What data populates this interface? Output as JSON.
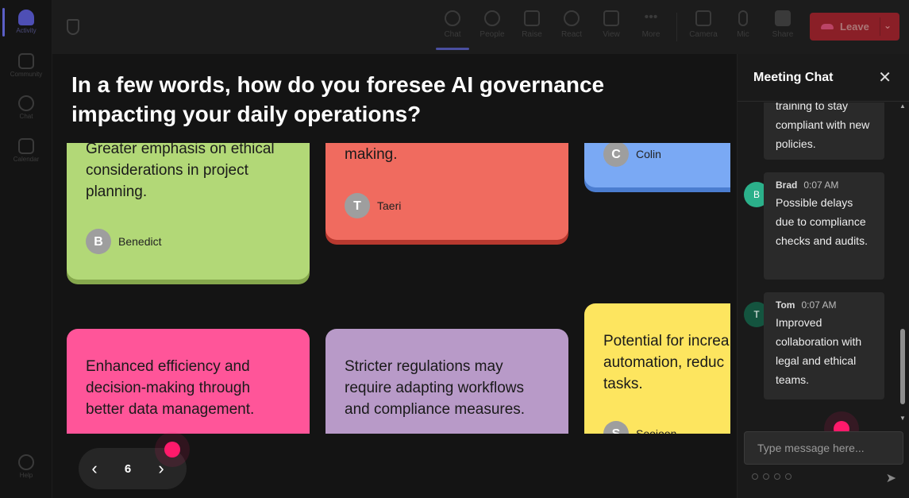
{
  "rail": {
    "items": [
      {
        "label": "Activity",
        "icon": "bell-icon"
      },
      {
        "label": "Community",
        "icon": "community-icon"
      },
      {
        "label": "Chat",
        "icon": "chat-icon"
      },
      {
        "label": "Calendar",
        "icon": "calendar-icon"
      },
      {
        "label": "Help",
        "icon": "help-icon"
      }
    ]
  },
  "toolbar": {
    "chat": "Chat",
    "people": "People",
    "raise": "Raise",
    "react": "React",
    "view": "View",
    "more": "More",
    "camera": "Camera",
    "mic": "Mic",
    "share": "Share",
    "leave": "Leave"
  },
  "stage": {
    "question": "In a few words, how do you foresee AI governance impacting your daily operations?",
    "cards": [
      {
        "text": "Greater emphasis on ethical considerations in project planning.",
        "author_initial": "B",
        "author": "Benedict",
        "color": "#b2d877"
      },
      {
        "text": "making.",
        "author_initial": "T",
        "author": "Taeri",
        "color": "#f06b5f"
      },
      {
        "text": "",
        "author_initial": "C",
        "author": "Colin",
        "color": "#7aa9f4"
      },
      {
        "text": "Enhanced efficiency and decision-making through better data management.",
        "color": "#ff5599"
      },
      {
        "text": "Stricter regulations may require adapting workflows and compliance measures.",
        "color": "#b89ac8"
      },
      {
        "text": "Potential for increa automation, reduc tasks.",
        "author_initial": "S",
        "author": "Seojoon",
        "color": "#fde55f"
      }
    ],
    "pager": {
      "prev": "‹",
      "page": "6",
      "next": "›"
    }
  },
  "chat": {
    "title": "Meeting Chat",
    "close": "✕",
    "messages": [
      {
        "text": "training to stay compliant with new policies."
      },
      {
        "name": "Brad",
        "time": "0:07 AM",
        "initial": "B",
        "avatar_color": "#2bb08a",
        "text": "Possible delays due to compliance checks and audits."
      },
      {
        "name": "Tom",
        "time": "0:07 AM",
        "initial": "T",
        "avatar_color": "#14543f",
        "text": "Improved collaboration with legal and ethical teams."
      }
    ],
    "input_placeholder": "Type message here...",
    "send": "➤"
  }
}
